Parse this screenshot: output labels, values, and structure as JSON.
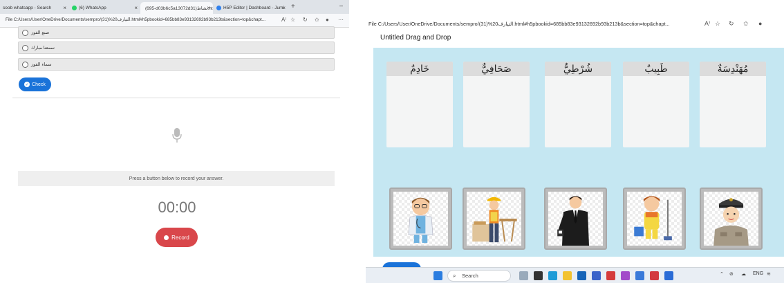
{
  "left_window": {
    "tabs": [
      {
        "label": "soob whatsapp - Search",
        "close": "×"
      },
      {
        "label": "(6) WhatsApp",
        "close": "×"
      },
      {
        "label": "(695-d03b6c5a13072d31)نشاط.html",
        "close": "×"
      },
      {
        "label": "H5P Editor | Dashboard - Jumi",
        "close": "×"
      }
    ],
    "new_tab": "+",
    "minimize": "–",
    "address": "File  C:/Users/User/OneDrive/Documents/sempro/(31)%20التيارف.html#h5pbookid=685bb83e93132692b93b213b&section=top&chapt...",
    "options": [
      {
        "label": "صنع الفوز"
      },
      {
        "label": "سمعنا مبارك"
      },
      {
        "label": "سماء الفوز"
      }
    ],
    "check_label": "Check",
    "record_prompt": "Press a button below to record your answer.",
    "timer": "00:00",
    "record_label": "Record"
  },
  "right_window": {
    "address": "File  C:/Users/User/OneDrive/Documents/sempro/(31)%20التيارف.html#h5pbookid=685bb83e93132692b93b213b&section=top&chapt...",
    "title": "Untitled Drag and Drop",
    "drop_zones": [
      {
        "word": "خَادِمٌ"
      },
      {
        "word": "صَحَافِيٌّ"
      },
      {
        "word": "شُرْطِيٌّ"
      },
      {
        "word": "طَبِيبٌ"
      },
      {
        "word": "مُهَنْدِسَةٌ"
      }
    ],
    "draggables": [
      {
        "name": "doctor-card"
      },
      {
        "name": "engineer-card"
      },
      {
        "name": "journalist-card"
      },
      {
        "name": "cleaner-card"
      },
      {
        "name": "police-card"
      }
    ],
    "taskbar": {
      "search_label": "Search",
      "lang": "ENG"
    }
  },
  "colors": {
    "check_blue": "#1a73d9",
    "record_red": "#d9474b",
    "board_bg": "#c5e7f2"
  }
}
